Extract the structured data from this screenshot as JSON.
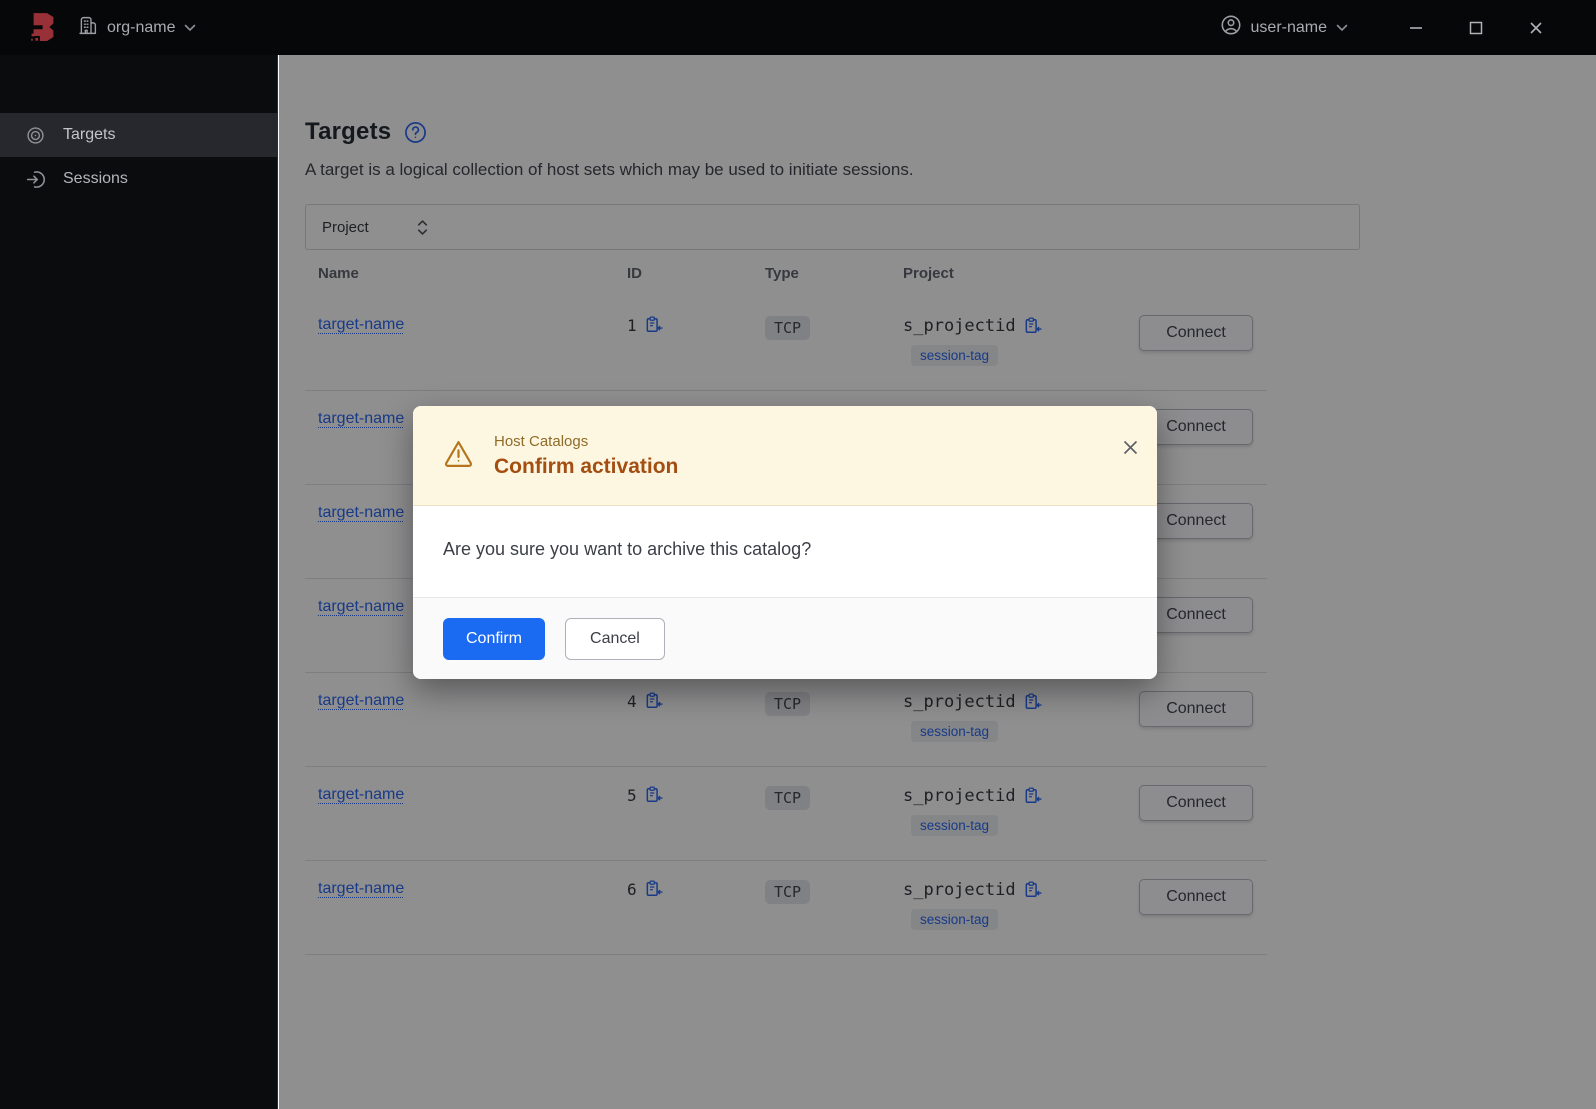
{
  "topbar": {
    "org_label": "org-name",
    "user_label": "user-name"
  },
  "sidebar": {
    "items": [
      {
        "label": "Targets",
        "active": true
      },
      {
        "label": "Sessions",
        "active": false
      }
    ]
  },
  "page": {
    "title": "Targets",
    "description": "A target is a logical collection of host sets which may be used to initiate sessions."
  },
  "filter": {
    "label": "Project"
  },
  "table": {
    "headers": [
      "Name",
      "ID",
      "Type",
      "Project"
    ],
    "connect_label": "Connect",
    "rows": [
      {
        "name": "target-name",
        "id": "1",
        "type": "TCP",
        "project": "s_projectid",
        "tag": "session-tag"
      },
      {
        "name": "target-name",
        "id": "",
        "type": "",
        "project": "",
        "tag": ""
      },
      {
        "name": "target-name",
        "id": "",
        "type": "",
        "project": "",
        "tag": ""
      },
      {
        "name": "target-name",
        "id": "",
        "type": "",
        "project": "",
        "tag": ""
      },
      {
        "name": "target-name",
        "id": "4",
        "type": "TCP",
        "project": "s_projectid",
        "tag": "session-tag"
      },
      {
        "name": "target-name",
        "id": "5",
        "type": "TCP",
        "project": "s_projectid",
        "tag": "session-tag"
      },
      {
        "name": "target-name",
        "id": "6",
        "type": "TCP",
        "project": "s_projectid",
        "tag": "session-tag"
      }
    ]
  },
  "modal": {
    "tagline": "Host Catalogs",
    "title": "Confirm activation",
    "body": "Are you sure you want to archive this catalog?",
    "confirm_label": "Confirm",
    "cancel_label": "Cancel"
  },
  "colors": {
    "accent_blue": "#1b6af2",
    "link_blue": "#2463f0",
    "warning_surface": "#fdf7e2",
    "warning_title": "#a44e11",
    "warning_tagline": "#8f6b28",
    "brand_red": "#983137"
  }
}
